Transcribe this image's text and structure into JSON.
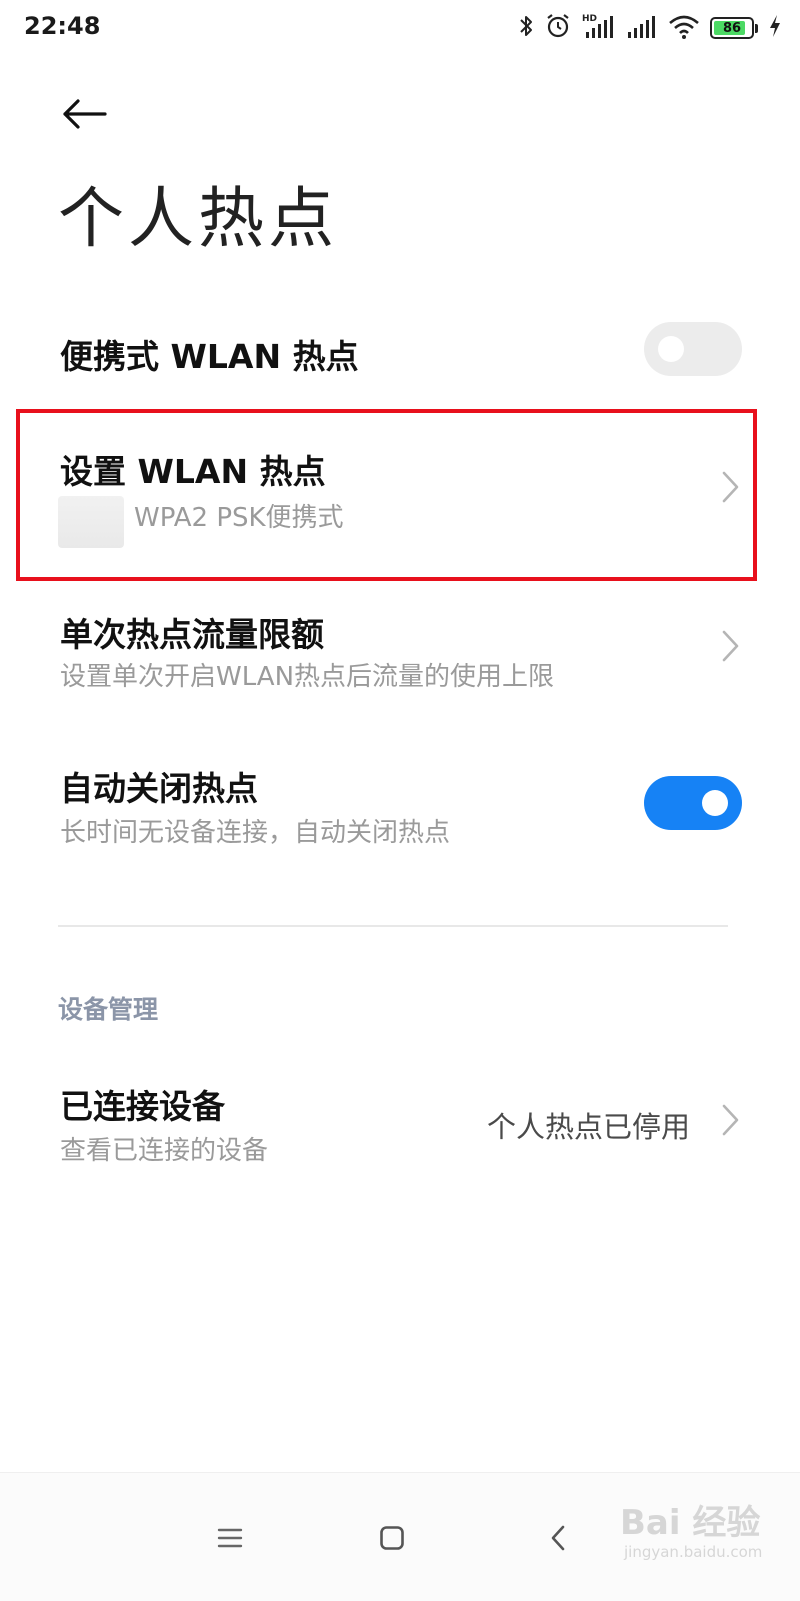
{
  "status_bar": {
    "time": "22:48",
    "battery_level": "86",
    "icons": [
      "bluetooth-icon",
      "alarm-icon",
      "hd-signal-icon",
      "signal-icon",
      "wifi-icon",
      "battery-icon",
      "charging-icon"
    ],
    "battery_color": "#4cd964"
  },
  "header": {
    "title": "个人热点"
  },
  "settings": {
    "portable_hotspot": {
      "label": "便携式 WLAN 热点",
      "toggle_on": false
    },
    "setup_hotspot": {
      "label": "设置 WLAN 热点",
      "subtitle": "WPA2 PSK便携式"
    },
    "data_limit": {
      "label": "单次热点流量限额",
      "subtitle": "设置单次开启WLAN热点后流量的使用上限"
    },
    "auto_close": {
      "label": "自动关闭热点",
      "subtitle": "长时间无设备连接，自动关闭热点",
      "toggle_on": true
    }
  },
  "device_section": {
    "header": "设备管理",
    "connected_devices": {
      "label": "已连接设备",
      "subtitle": "查看已连接的设备",
      "value": "个人热点已停用"
    }
  },
  "watermark": {
    "brand": "Bai 经验",
    "url": "jingyan.baidu.com"
  },
  "colors": {
    "accent": "#1682f5",
    "highlight": "#e8101c",
    "section_header": "#8b95a8"
  }
}
